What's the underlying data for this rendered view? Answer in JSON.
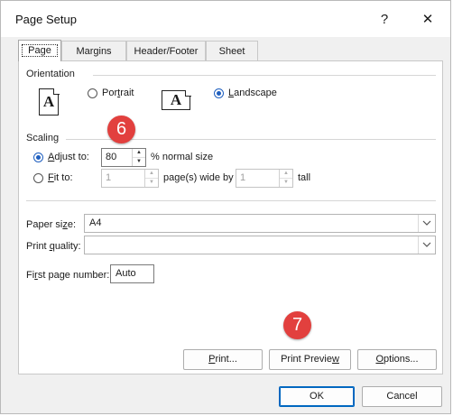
{
  "window": {
    "title": "Page Setup",
    "help": "?",
    "close": "✕"
  },
  "tabs": [
    {
      "label": "Page",
      "active": true
    },
    {
      "label": "Margins",
      "active": false
    },
    {
      "label": "Header/Footer",
      "active": false
    },
    {
      "label": "Sheet",
      "active": false
    }
  ],
  "orientation": {
    "label": "Orientation",
    "portrait_prefix": "Por",
    "portrait_underline": "t",
    "portrait_suffix": "rait",
    "landscape_underline": "L",
    "landscape_suffix": "andscape",
    "selected": "landscape",
    "icon_glyph": "A"
  },
  "scaling": {
    "label": "Scaling",
    "adjust_underline": "A",
    "adjust_suffix": "djust to:",
    "adjust_value": "80",
    "adjust_unit": "% normal size",
    "fit_underline": "F",
    "fit_suffix": "it to:",
    "fit_wide_value": "1",
    "fit_wide_unit": "page(s) wide by",
    "fit_tall_value": "1",
    "fit_tall_unit": "tall",
    "selected": "adjust",
    "spin_up": "▲",
    "spin_down": "▼"
  },
  "paper": {
    "size_prefix": "Paper si",
    "size_underline": "z",
    "size_suffix": "e:",
    "size_value": "A4",
    "quality_prefix": "Print ",
    "quality_underline": "q",
    "quality_suffix": "uality:",
    "quality_value": "",
    "first_page_prefix": "Fi",
    "first_page_underline": "r",
    "first_page_suffix": "st page number:",
    "first_page_value": "Auto"
  },
  "buttons": {
    "print_underline": "P",
    "print_suffix": "rint...",
    "preview_prefix": "Print Previe",
    "preview_underline": "w",
    "options_underline": "O",
    "options_suffix": "ptions...",
    "ok": "OK",
    "cancel": "Cancel"
  },
  "callouts": {
    "step6": "6",
    "step7": "7",
    "color": "#e2403e"
  }
}
